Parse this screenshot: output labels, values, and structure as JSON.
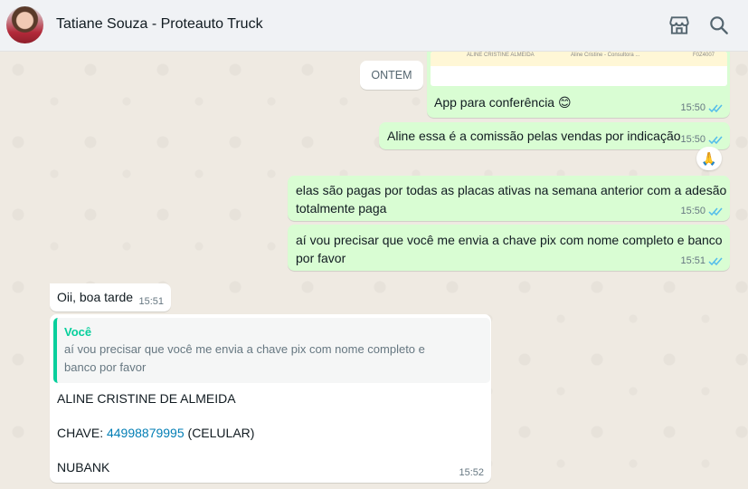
{
  "header": {
    "contact_name": "Tatiane Souza - Proteauto Truck",
    "store_icon": "storefront-icon",
    "search_icon": "search-icon"
  },
  "date_chip": "ONTEM",
  "image_preview": {
    "left_text": "ALINE CRISTINE ALMEIDA",
    "mid_text": "Aline Cristine - Consultora ...",
    "right_text": "F0Z4007"
  },
  "messages": [
    {
      "direction": "out",
      "text": "App para conferência",
      "emoji": "😊",
      "time": "15:50"
    },
    {
      "direction": "out",
      "text": "Aline essa é a comissão pelas vendas por indicação",
      "time": "15:50",
      "reaction": "🙏"
    },
    {
      "direction": "out",
      "line1": "elas são pagas por todas as placas ativas na semana anterior com a adesão",
      "line2": "totalmente paga",
      "time": "15:50"
    },
    {
      "direction": "out",
      "line1": "aí vou precisar que você me envia a chave pix com nome completo e banco",
      "line2": "por favor",
      "time": "15:51"
    },
    {
      "direction": "in",
      "text": "Oii, boa tarde",
      "time": "15:51"
    },
    {
      "direction": "in",
      "quote": {
        "author": "Você",
        "line1": "aí vou precisar que você me envia a chave pix com nome completo e",
        "line2": "banco por favor"
      },
      "name_line": "ALINE CRISTINE DE ALMEIDA",
      "key_label": "CHAVE: ",
      "key_value": "44998879995",
      "key_suffix": " (CELULAR)",
      "bank": "NUBANK",
      "time": "15:52"
    }
  ],
  "colors": {
    "outgoing_bubble": "#d9fdd3",
    "incoming_bubble": "#ffffff",
    "chat_background": "#efeae2",
    "read_ticks": "#53bdeb",
    "quote_accent": "#06cf9c",
    "link": "#027eb5"
  }
}
